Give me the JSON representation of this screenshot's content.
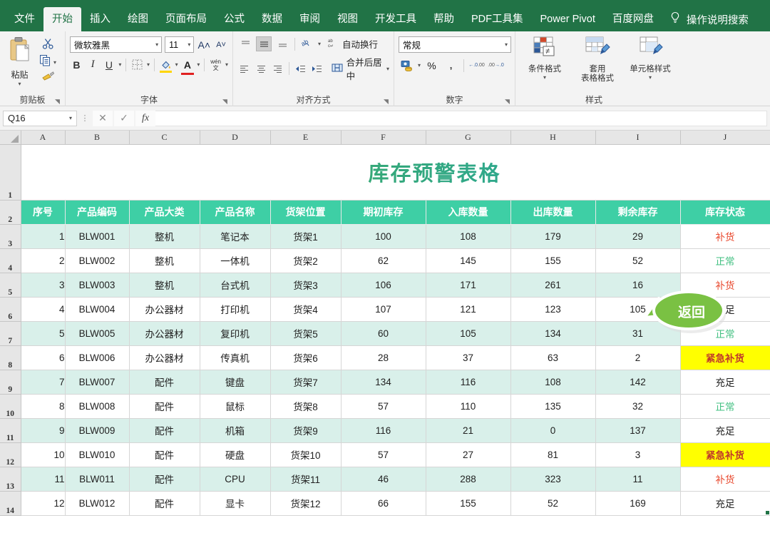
{
  "ribbon": {
    "tabs": [
      {
        "label": "文件",
        "active": false
      },
      {
        "label": "开始",
        "active": true
      },
      {
        "label": "插入",
        "active": false
      },
      {
        "label": "绘图",
        "active": false
      },
      {
        "label": "页面布局",
        "active": false
      },
      {
        "label": "公式",
        "active": false
      },
      {
        "label": "数据",
        "active": false
      },
      {
        "label": "审阅",
        "active": false
      },
      {
        "label": "视图",
        "active": false
      },
      {
        "label": "开发工具",
        "active": false
      },
      {
        "label": "帮助",
        "active": false
      },
      {
        "label": "PDF工具集",
        "active": false
      },
      {
        "label": "Power Pivot",
        "active": false
      },
      {
        "label": "百度网盘",
        "active": false
      }
    ],
    "tell_me": "操作说明搜索",
    "lamp_icon": "lightbulb-icon",
    "groups": {
      "clipboard": {
        "name": "剪贴板",
        "paste_label": "粘贴",
        "cut_icon": "scissors-icon",
        "copy_icon": "copy-icon",
        "format_painter_icon": "format-painter-icon"
      },
      "font": {
        "name": "字体",
        "font_name": "微软雅黑",
        "font_size": "11",
        "grow_icon": "grow-font-icon",
        "shrink_icon": "shrink-font-icon",
        "bold": "B",
        "italic": "I",
        "underline": "U",
        "border_icon": "borders-icon",
        "fill_icon": "fill-color-icon",
        "font_color_icon": "font-color-icon",
        "phonetic_icon": "phonetic-guide-icon"
      },
      "alignment": {
        "name": "对齐方式",
        "wrap_text": "自动换行",
        "merge_center": "合并后居中",
        "orientation_icon": "text-orientation-icon",
        "indent_decrease_icon": "decrease-indent-icon",
        "indent_increase_icon": "increase-indent-icon"
      },
      "number": {
        "name": "数字",
        "format": "常规",
        "accounting_icon": "accounting-format-icon",
        "percent": "%",
        "comma": ",",
        "decrease_decimal_icon": "decrease-decimal-icon",
        "increase_decimal_icon": "increase-decimal-icon"
      },
      "styles": {
        "name": "样式",
        "conditional": "条件格式",
        "table_format_l1": "套用",
        "table_format_l2": "表格格式",
        "cell_styles": "单元格样式"
      }
    }
  },
  "formula_bar": {
    "name_box": "Q16",
    "cancel_icon": "cancel-icon",
    "confirm_icon": "confirm-icon",
    "fx_icon": "fx-icon",
    "formula_value": ""
  },
  "sheet": {
    "column_headers": [
      "A",
      "B",
      "C",
      "D",
      "E",
      "F",
      "G",
      "H",
      "I",
      "J"
    ],
    "row_numbers": [
      "1",
      "2",
      "3",
      "4",
      "5",
      "6",
      "7",
      "8",
      "9",
      "10",
      "11",
      "12",
      "13",
      "14"
    ],
    "title": "库存预警表格",
    "return_button": "返回",
    "table_headers": [
      "序号",
      "产品编码",
      "产品大类",
      "产品名称",
      "货架位置",
      "期初库存",
      "入库数量",
      "出库数量",
      "剩余库存",
      "库存状态"
    ],
    "rows": [
      {
        "idx": "1",
        "code": "BLW001",
        "category": "整机",
        "name": "笔记本",
        "shelf": "货架1",
        "opening": "100",
        "inbound": "108",
        "outbound": "179",
        "remaining": "29",
        "status": "补货",
        "status_style": "red",
        "band": true
      },
      {
        "idx": "2",
        "code": "BLW002",
        "category": "整机",
        "name": "一体机",
        "shelf": "货架2",
        "opening": "62",
        "inbound": "145",
        "outbound": "155",
        "remaining": "52",
        "status": "正常",
        "status_style": "green",
        "band": false
      },
      {
        "idx": "3",
        "code": "BLW003",
        "category": "整机",
        "name": "台式机",
        "shelf": "货架3",
        "opening": "106",
        "inbound": "171",
        "outbound": "261",
        "remaining": "16",
        "status": "补货",
        "status_style": "red",
        "band": true
      },
      {
        "idx": "4",
        "code": "BLW004",
        "category": "办公器材",
        "name": "打印机",
        "shelf": "货架4",
        "opening": "107",
        "inbound": "121",
        "outbound": "123",
        "remaining": "105",
        "status": "充足",
        "status_style": "black",
        "band": false
      },
      {
        "idx": "5",
        "code": "BLW005",
        "category": "办公器材",
        "name": "复印机",
        "shelf": "货架5",
        "opening": "60",
        "inbound": "105",
        "outbound": "134",
        "remaining": "31",
        "status": "正常",
        "status_style": "green",
        "band": true
      },
      {
        "idx": "6",
        "code": "BLW006",
        "category": "办公器材",
        "name": "传真机",
        "shelf": "货架6",
        "opening": "28",
        "inbound": "37",
        "outbound": "63",
        "remaining": "2",
        "status": "紧急补货",
        "status_style": "urgent",
        "band": false
      },
      {
        "idx": "7",
        "code": "BLW007",
        "category": "配件",
        "name": "键盘",
        "shelf": "货架7",
        "opening": "134",
        "inbound": "116",
        "outbound": "108",
        "remaining": "142",
        "status": "充足",
        "status_style": "black",
        "band": true
      },
      {
        "idx": "8",
        "code": "BLW008",
        "category": "配件",
        "name": "鼠标",
        "shelf": "货架8",
        "opening": "57",
        "inbound": "110",
        "outbound": "135",
        "remaining": "32",
        "status": "正常",
        "status_style": "green",
        "band": false
      },
      {
        "idx": "9",
        "code": "BLW009",
        "category": "配件",
        "name": "机箱",
        "shelf": "货架9",
        "opening": "116",
        "inbound": "21",
        "outbound": "0",
        "remaining": "137",
        "status": "充足",
        "status_style": "black",
        "band": true
      },
      {
        "idx": "10",
        "code": "BLW010",
        "category": "配件",
        "name": "硬盘",
        "shelf": "货架10",
        "opening": "57",
        "inbound": "27",
        "outbound": "81",
        "remaining": "3",
        "status": "紧急补货",
        "status_style": "urgent",
        "band": false
      },
      {
        "idx": "11",
        "code": "BLW011",
        "category": "配件",
        "name": "CPU",
        "shelf": "货架11",
        "opening": "46",
        "inbound": "288",
        "outbound": "323",
        "remaining": "11",
        "status": "补货",
        "status_style": "red",
        "band": true
      },
      {
        "idx": "12",
        "code": "BLW012",
        "category": "配件",
        "name": "显卡",
        "shelf": "货架12",
        "opening": "66",
        "inbound": "155",
        "outbound": "52",
        "remaining": "169",
        "status": "充足",
        "status_style": "black",
        "band": false
      }
    ]
  },
  "colors": {
    "brand_green": "#217346",
    "header_teal": "#3ecfa5",
    "band": "#d9f0ea",
    "status_red": "#e8462b",
    "status_green": "#3fbf7f",
    "urgent_bg": "#ffff00",
    "callout_green": "#7ac143"
  }
}
